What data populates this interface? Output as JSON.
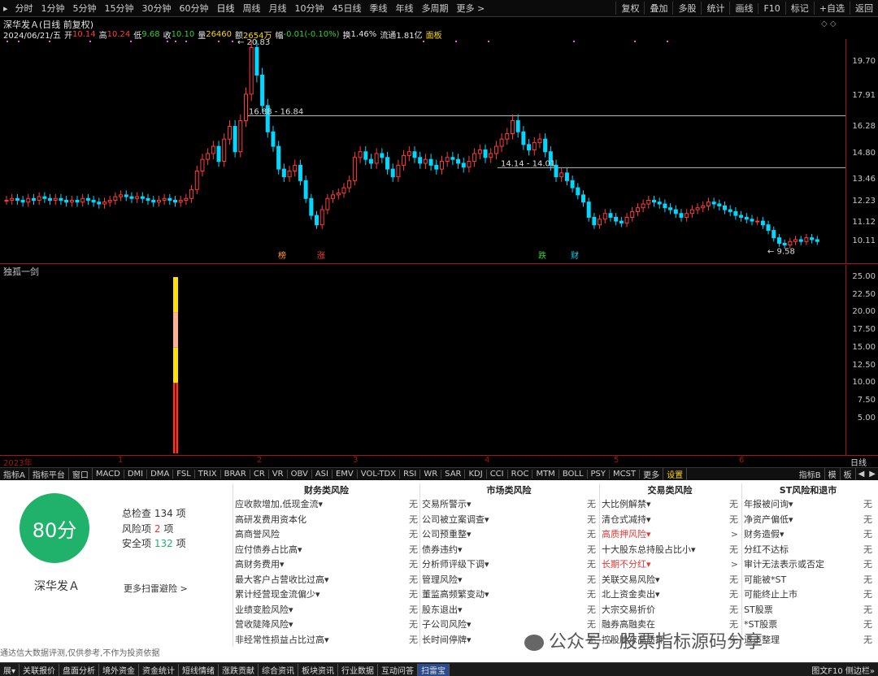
{
  "toolbar": {
    "periods": [
      "分时",
      "1分钟",
      "5分钟",
      "15分钟",
      "30分钟",
      "60分钟",
      "日线",
      "周线",
      "月线",
      "10分钟",
      "45日线",
      "季线",
      "年线",
      "多周期",
      "更多 >"
    ],
    "right": [
      "复权",
      "叠加",
      "多股",
      "统计",
      "画线",
      "F10",
      "标记",
      "+自选",
      "返回"
    ]
  },
  "info": {
    "name": "深华发Ａ(日线 前复权)",
    "date": "2024/06/21/五",
    "open_l": "开",
    "open": "10.14",
    "high_l": "高",
    "high": "10.24",
    "low_l": "低",
    "low": "9.68",
    "close_l": "收",
    "close": "10.10",
    "vol_l": "量",
    "vol": "26460",
    "amt_l": "额",
    "amt": "2654万",
    "chg_l": "幅",
    "chg": "-0.01(-0.10%)",
    "turn_l": "换",
    "turn": "1.46%",
    "float_l": "流通",
    "float": "1.81亿",
    "panel": "面板"
  },
  "price_axis": [
    "19.70",
    "17.91",
    "16.28",
    "14.80",
    "13.46",
    "12.23",
    "11.12",
    "10.11"
  ],
  "annotations": {
    "high": "20.83",
    "low": "9.58",
    "gap1": "16.88 - 16.84",
    "gap2": "14.14 - 14.01"
  },
  "markers": [
    "榜",
    "涨",
    "跌",
    "财"
  ],
  "indicator": {
    "name": "独孤一剑",
    "axis": [
      "25.00",
      "22.50",
      "20.00",
      "17.50",
      "15.00",
      "12.50",
      "10.00",
      "7.50",
      "5.00"
    ]
  },
  "time_axis": {
    "year": "2023年",
    "months": [
      "1",
      "2",
      "3",
      "4",
      "5",
      "6"
    ],
    "period": "日线"
  },
  "tabs": [
    "指标A",
    "指标平台",
    "窗口",
    "MACD",
    "DMI",
    "DMA",
    "FSL",
    "TRIX",
    "BRAR",
    "CR",
    "VR",
    "OBV",
    "ASI",
    "EMV",
    "VOL-TDX",
    "RSI",
    "WR",
    "SAR",
    "KDJ",
    "CCI",
    "ROC",
    "MTM",
    "BOLL",
    "PSY",
    "MCST",
    "更多",
    "设置"
  ],
  "tabs_right": [
    "指标B",
    "模",
    "板"
  ],
  "scan": {
    "score": "80分",
    "name": "深华发Ａ",
    "total_l": "总检查",
    "total": "134",
    "total_u": "项",
    "risk_l": "风险项",
    "risk": "2",
    "risk_u": "项",
    "safe_l": "安全项",
    "safe": "132",
    "safe_u": "项",
    "more": "更多扫雷避险 >",
    "disclaimer": "通达信大数据评测,仅供参考,不作为投资依据"
  },
  "columns": [
    {
      "title": "财务类风险",
      "rows": [
        [
          "应收款增加,低现金流▾",
          "无"
        ],
        [
          "高研发费用资本化",
          "无"
        ],
        [
          "高商誉风险",
          "无"
        ],
        [
          "应付债券占比高▾",
          "无"
        ],
        [
          "高财务费用▾",
          "无"
        ],
        [
          "最大客户占营收比过高▾",
          "无"
        ],
        [
          "累计经营现金流偏少▾",
          "无"
        ],
        [
          "业绩变脸风险▾",
          "无"
        ],
        [
          "营收陡降风险▾",
          "无"
        ],
        [
          "非经常性损益占比过高▾",
          "无"
        ]
      ]
    },
    {
      "title": "市场类风险",
      "rows": [
        [
          "交易所警示▾",
          "无"
        ],
        [
          "公司被立案调查▾",
          "无"
        ],
        [
          "公司预重整▾",
          "无"
        ],
        [
          "债券违约▾",
          "无"
        ],
        [
          "分析师评级下调▾",
          "无"
        ],
        [
          "管理风险▾",
          "无"
        ],
        [
          "董监高频繁变动▾",
          "无"
        ],
        [
          "股东退出▾",
          "无"
        ],
        [
          "子公司风险▾",
          "无"
        ],
        [
          "长时间停牌▾",
          "无"
        ]
      ]
    },
    {
      "title": "交易类风险",
      "rows": [
        [
          "大比例解禁▾",
          "无"
        ],
        [
          "清仓式减持▾",
          "无"
        ],
        [
          "高质押风险▾",
          ">"
        ],
        [
          "十大股东总持股占比小▾",
          "无"
        ],
        [
          "长期不分红▾",
          ">"
        ],
        [
          "关联交易风险▾",
          "无"
        ],
        [
          "北上资金卖出▾",
          "无"
        ],
        [
          "大宗交易折价",
          "无"
        ],
        [
          "融券高融卖在",
          "无"
        ],
        [
          "控股股东高质押",
          "无"
        ]
      ]
    },
    {
      "title": "ST风险和退市",
      "rows": [
        [
          "年报被问询▾",
          "无"
        ],
        [
          "净资产偏低▾",
          "无"
        ],
        [
          "财务造假▾",
          "无"
        ],
        [
          "分红不达标",
          "无"
        ],
        [
          "审计无法表示或否定",
          "无"
        ],
        [
          "可能被*ST",
          "无"
        ],
        [
          "可能终止上市",
          "无"
        ],
        [
          "ST股票",
          "无"
        ],
        [
          "*ST股票",
          "无"
        ],
        [
          "退市整理",
          "无"
        ]
      ]
    }
  ],
  "statusbar": [
    "展▾",
    "关联报价",
    "盘面分析",
    "境外资金",
    "资金统计",
    "短线情绪",
    "涨跌贡献",
    "综合资讯",
    "板块资讯",
    "行业数据",
    "互动问答",
    "扫雷宝"
  ],
  "statusbar_right": "图文F10 侧边栏»",
  "watermark": "公众号 · 股票指标源码分享"
}
